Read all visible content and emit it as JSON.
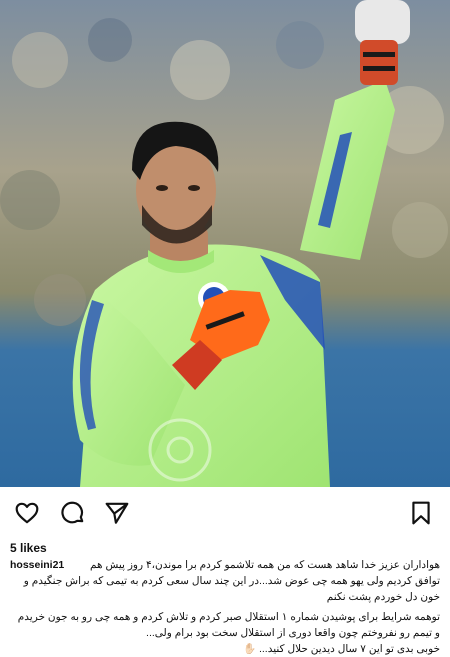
{
  "post": {
    "likes": "5 likes",
    "username": "hosseini21",
    "caption_lines": [
      "هواداران عزیز خدا شاهد هست که من همه تلاشمو کردم برا موندن،۴ روز پیش هم",
      "توافق کردیم ولی یهو همه چی عوض شد...در این چند سال سعی کردم به تیمی که براش جنگیدم و",
      "خون دل خوردم پشت نکنم",
      "توهمه شرایط برای پوشیدن شماره ۱ استقلال صبر کردم و تلاش کردم و همه چی رو به جون خریدم",
      "و تیمم رو نفروختم چون واقعا دوری از استقلال سخت بود برام ولی...",
      "خوبی بدی تو این ۷ سال دیدین حلال کنید..."
    ],
    "emoji": "✋🏻"
  },
  "colors": {
    "jersey": "#b6f08a",
    "sleeve_stripe": "#2350b8",
    "glove": "#ff6a1a",
    "background_blue": "#3a6f9e"
  },
  "icons": [
    "heart-icon",
    "comment-icon",
    "share-icon",
    "bookmark-icon"
  ]
}
